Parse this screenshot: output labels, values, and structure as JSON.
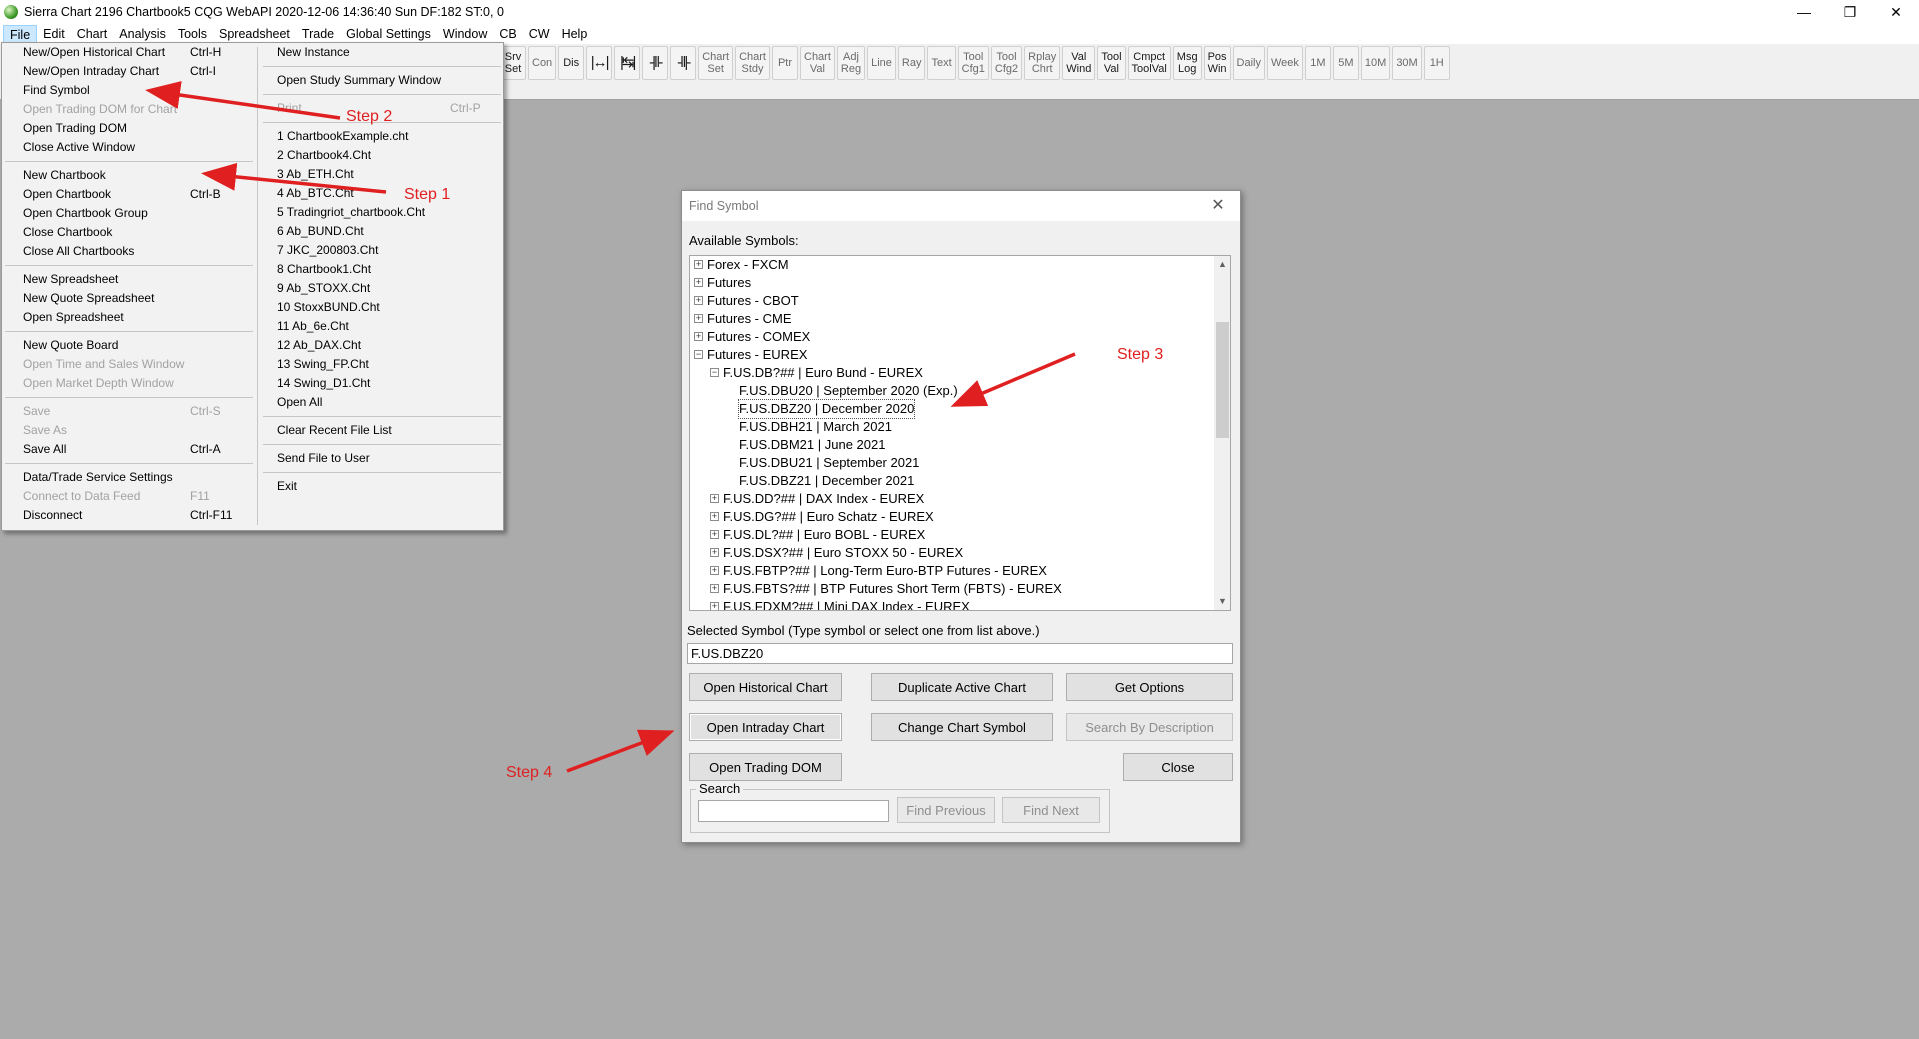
{
  "window": {
    "title": "Sierra Chart 2196 Chartbook5  CQG WebAPI 2020-12-06  14:36:40 Sun  DF:182  ST:0, 0",
    "minimize_glyph": "—",
    "maximize_glyph": "❐",
    "close_glyph": "✕"
  },
  "menubar": {
    "items": [
      {
        "label": "File"
      },
      {
        "label": "Edit"
      },
      {
        "label": "Chart"
      },
      {
        "label": "Analysis"
      },
      {
        "label": "Tools"
      },
      {
        "label": "Spreadsheet"
      },
      {
        "label": "Trade"
      },
      {
        "label": "Global Settings"
      },
      {
        "label": "Window"
      },
      {
        "label": "CB"
      },
      {
        "label": "CW"
      },
      {
        "label": "Help"
      }
    ]
  },
  "toolbar": {
    "buttons": [
      {
        "label": "Srv\nSet",
        "faded": false
      },
      {
        "label": "Con",
        "faded": true
      },
      {
        "label": "Dis",
        "faded": false
      },
      {
        "label": "",
        "icon": "|↔|"
      },
      {
        "label": "",
        "icon": "|↹|"
      },
      {
        "label": "",
        "icon": "-|‖-"
      },
      {
        "label": "",
        "icon": "-‖|-"
      },
      {
        "label": "Chart\nSet",
        "faded": true
      },
      {
        "label": "Chart\nStdy",
        "faded": true
      },
      {
        "label": "Ptr",
        "faded": true
      },
      {
        "label": "Chart\nVal",
        "faded": true
      },
      {
        "label": "Adj\nReg",
        "faded": true
      },
      {
        "label": "Line",
        "faded": true
      },
      {
        "label": "Ray",
        "faded": true
      },
      {
        "label": "Text",
        "faded": true
      },
      {
        "label": "Tool\nCfg1",
        "faded": true
      },
      {
        "label": "Tool\nCfg2",
        "faded": true
      },
      {
        "label": "Rplay\nChrt",
        "faded": true
      },
      {
        "label": "Val\nWind",
        "faded": false
      },
      {
        "label": "Tool\nVal",
        "faded": false
      },
      {
        "label": "Cmpct\nToolVal",
        "faded": false
      },
      {
        "label": "Msg\nLog",
        "faded": false
      },
      {
        "label": "Pos\nWin",
        "faded": false
      },
      {
        "label": "Daily",
        "faded": true
      },
      {
        "label": "Week",
        "faded": true
      },
      {
        "label": "1M",
        "faded": true
      },
      {
        "label": "5M",
        "faded": true
      },
      {
        "label": "10M",
        "faded": true
      },
      {
        "label": "30M",
        "faded": true
      },
      {
        "label": "1H",
        "faded": true
      }
    ]
  },
  "file_menu": {
    "left": [
      {
        "label": "New/Open Historical Chart",
        "shortcut": "Ctrl-H"
      },
      {
        "label": "New/Open Intraday Chart",
        "shortcut": "Ctrl-I"
      },
      {
        "label": "Find Symbol",
        "shortcut": ""
      },
      {
        "label": "Open Trading DOM for Chart",
        "shortcut": "",
        "disabled": true
      },
      {
        "label": "Open Trading DOM",
        "shortcut": ""
      },
      {
        "label": "Close Active Window",
        "shortcut": ""
      },
      {
        "sep": true
      },
      {
        "label": "New Chartbook",
        "shortcut": ""
      },
      {
        "label": "Open Chartbook",
        "shortcut": "Ctrl-B"
      },
      {
        "label": "Open Chartbook Group",
        "shortcut": ""
      },
      {
        "label": "Close Chartbook",
        "shortcut": ""
      },
      {
        "label": "Close All Chartbooks",
        "shortcut": ""
      },
      {
        "sep": true
      },
      {
        "label": "New Spreadsheet",
        "shortcut": ""
      },
      {
        "label": "New Quote Spreadsheet",
        "shortcut": ""
      },
      {
        "label": "Open Spreadsheet",
        "shortcut": ""
      },
      {
        "sep": true
      },
      {
        "label": "New Quote Board",
        "shortcut": ""
      },
      {
        "label": "Open Time and Sales Window",
        "shortcut": "",
        "disabled": true
      },
      {
        "label": "Open Market Depth Window",
        "shortcut": "",
        "disabled": true
      },
      {
        "sep": true
      },
      {
        "label": "Save",
        "shortcut": "Ctrl-S",
        "disabled": true
      },
      {
        "label": "Save As",
        "shortcut": "",
        "disabled": true
      },
      {
        "label": "Save All",
        "shortcut": "Ctrl-A"
      },
      {
        "sep": true
      },
      {
        "label": "Data/Trade Service Settings",
        "shortcut": ""
      },
      {
        "label": "Connect to Data Feed",
        "shortcut": "F11",
        "disabled": true
      },
      {
        "label": "Disconnect",
        "shortcut": "Ctrl-F11"
      }
    ],
    "right": [
      {
        "label": "New Instance",
        "shortcut": ""
      },
      {
        "sep": true
      },
      {
        "label": "Open Study Summary Window",
        "shortcut": ""
      },
      {
        "sep": true
      },
      {
        "label": "Print",
        "shortcut": "Ctrl-P",
        "disabled": true
      },
      {
        "sep": true
      },
      {
        "label": "1 ChartbookExample.cht",
        "shortcut": ""
      },
      {
        "label": "2 Chartbook4.Cht",
        "shortcut": ""
      },
      {
        "label": "3 Ab_ETH.Cht",
        "shortcut": ""
      },
      {
        "label": "4 Ab_BTC.Cht",
        "shortcut": ""
      },
      {
        "label": "5 Tradingriot_chartbook.Cht",
        "shortcut": ""
      },
      {
        "label": "6 Ab_BUND.Cht",
        "shortcut": ""
      },
      {
        "label": "7 JKC_200803.Cht",
        "shortcut": ""
      },
      {
        "label": "8 Chartbook1.Cht",
        "shortcut": ""
      },
      {
        "label": "9 Ab_STOXX.Cht",
        "shortcut": ""
      },
      {
        "label": "10 StoxxBUND.Cht",
        "shortcut": ""
      },
      {
        "label": "11 Ab_6e.Cht",
        "shortcut": ""
      },
      {
        "label": "12 Ab_DAX.Cht",
        "shortcut": ""
      },
      {
        "label": "13 Swing_FP.Cht",
        "shortcut": ""
      },
      {
        "label": "14 Swing_D1.Cht",
        "shortcut": ""
      },
      {
        "label": "Open All",
        "shortcut": ""
      },
      {
        "sep": true
      },
      {
        "label": "Clear Recent File List",
        "shortcut": ""
      },
      {
        "sep": true
      },
      {
        "label": "Send File to User",
        "shortcut": ""
      },
      {
        "sep": true
      },
      {
        "label": "Exit",
        "shortcut": ""
      }
    ]
  },
  "dialog": {
    "title": "Find Symbol",
    "close_glyph": "✕",
    "available_label": "Available Symbols:",
    "tree": [
      {
        "depth": 0,
        "toggle": "+",
        "label": "Forex - FXCM"
      },
      {
        "depth": 0,
        "toggle": "+",
        "label": "Futures"
      },
      {
        "depth": 0,
        "toggle": "+",
        "label": "Futures - CBOT"
      },
      {
        "depth": 0,
        "toggle": "+",
        "label": "Futures - CME"
      },
      {
        "depth": 0,
        "toggle": "+",
        "label": "Futures - COMEX"
      },
      {
        "depth": 0,
        "toggle": "−",
        "label": "Futures - EUREX"
      },
      {
        "depth": 1,
        "toggle": "−",
        "label": "F.US.DB?##  |  Euro Bund - EUREX"
      },
      {
        "depth": 2,
        "toggle": "",
        "label": "F.US.DBU20  |  September 2020 (Exp.)"
      },
      {
        "depth": 2,
        "toggle": "",
        "label": "F.US.DBZ20  |  December 2020",
        "selected": true
      },
      {
        "depth": 2,
        "toggle": "",
        "label": "F.US.DBH21  |  March 2021"
      },
      {
        "depth": 2,
        "toggle": "",
        "label": "F.US.DBM21  |  June 2021"
      },
      {
        "depth": 2,
        "toggle": "",
        "label": "F.US.DBU21  |  September 2021"
      },
      {
        "depth": 2,
        "toggle": "",
        "label": "F.US.DBZ21  |  December 2021"
      },
      {
        "depth": 1,
        "toggle": "+",
        "label": "F.US.DD?##  |  DAX Index - EUREX"
      },
      {
        "depth": 1,
        "toggle": "+",
        "label": "F.US.DG?##  |  Euro Schatz - EUREX"
      },
      {
        "depth": 1,
        "toggle": "+",
        "label": "F.US.DL?##  |  Euro BOBL - EUREX"
      },
      {
        "depth": 1,
        "toggle": "+",
        "label": "F.US.DSX?##  |  Euro STOXX 50 - EUREX"
      },
      {
        "depth": 1,
        "toggle": "+",
        "label": "F.US.FBTP?##  |  Long-Term Euro-BTP Futures - EUREX"
      },
      {
        "depth": 1,
        "toggle": "+",
        "label": "F.US.FBTS?##  |  BTP Futures Short Term (FBTS) - EUREX"
      },
      {
        "depth": 1,
        "toggle": "+",
        "label": "F.US.FDXM?##  |  Mini DAX Index - EUREX"
      }
    ],
    "scroll_up_glyph": "▲",
    "scroll_down_glyph": "▼",
    "selected_label": "Selected Symbol (Type symbol or select one from list above.)",
    "selected_value": "F.US.DBZ20",
    "buttons": {
      "open_historical": "Open Historical Chart",
      "duplicate_active": "Duplicate Active Chart",
      "get_options": "Get Options",
      "open_intraday": "Open Intraday Chart",
      "change_symbol": "Change Chart Symbol",
      "search_by_description": "Search By Description",
      "open_trading_dom": "Open Trading DOM",
      "close": "Close",
      "find_previous": "Find Previous",
      "find_next": "Find Next"
    },
    "search_legend": "Search",
    "search_value": ""
  },
  "annotations": {
    "color": "#e02020",
    "step1": "Step 1",
    "step2": "Step 2",
    "step3": "Step 3",
    "step4": "Step 4"
  }
}
